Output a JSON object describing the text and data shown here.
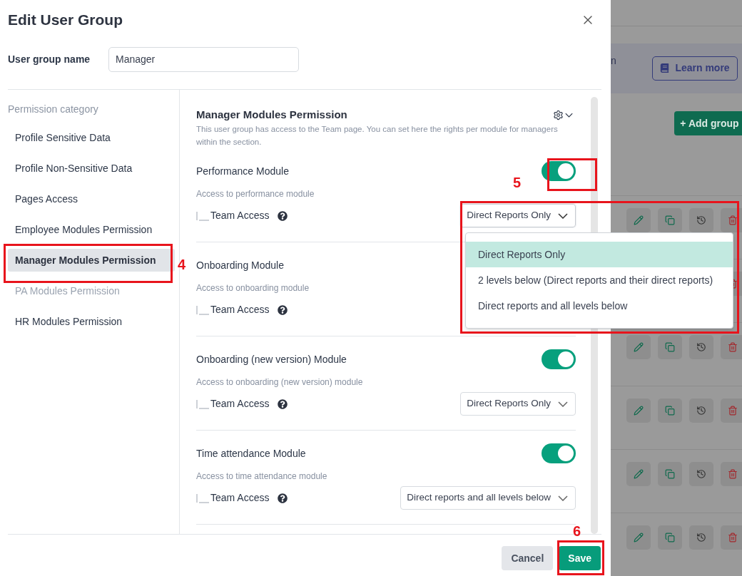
{
  "dialog": {
    "title": "Edit User Group",
    "name_label": "User group name",
    "name_value": "Manager"
  },
  "sidebar": {
    "heading": "Permission category",
    "items": [
      {
        "label": "Profile Sensitive Data",
        "selected": false,
        "disabled": false
      },
      {
        "label": "Profile Non-Sensitive Data",
        "selected": false,
        "disabled": false
      },
      {
        "label": "Pages Access",
        "selected": false,
        "disabled": false
      },
      {
        "label": "Employee Modules Permission",
        "selected": false,
        "disabled": false
      },
      {
        "label": "Manager Modules Permission",
        "selected": true,
        "disabled": false
      },
      {
        "label": "PA Modules Permission",
        "selected": false,
        "disabled": true
      },
      {
        "label": "HR Modules Permission",
        "selected": false,
        "disabled": false
      }
    ]
  },
  "section": {
    "title": "Manager Modules Permission",
    "description": "This user group has access to the Team page. You can set here the rights per module for managers within the section."
  },
  "modules": [
    {
      "title": "Performance Module",
      "subtitle": "Access to performance module",
      "on": true,
      "access_label": "Team Access",
      "access_value": "Direct Reports Only",
      "open": true
    },
    {
      "title": "Onboarding Module",
      "subtitle": "Access to onboarding module",
      "access_label": "Team Access"
    },
    {
      "title": "Onboarding (new version) Module",
      "subtitle": "Access to onboarding (new version) module",
      "on": true,
      "access_label": "Team Access",
      "access_value": "Direct Reports Only",
      "open": false
    },
    {
      "title": "Time attendance Module",
      "subtitle": "Access to time attendance module",
      "on": true,
      "access_label": "Team Access",
      "access_value": "Direct reports and all levels below",
      "open": false
    }
  ],
  "dropdown_options": [
    {
      "label": "Direct Reports Only",
      "selected": true
    },
    {
      "label": "2 levels below (Direct reports and their direct reports)",
      "selected": false
    },
    {
      "label": "Direct reports and all levels below",
      "selected": false
    }
  ],
  "footer": {
    "cancel": "Cancel",
    "save": "Save"
  },
  "background": {
    "banner_text": "n",
    "learn_more": "Learn more",
    "add_group": "+ Add group"
  },
  "annotation_labels": [
    "4",
    "5",
    "6"
  ]
}
